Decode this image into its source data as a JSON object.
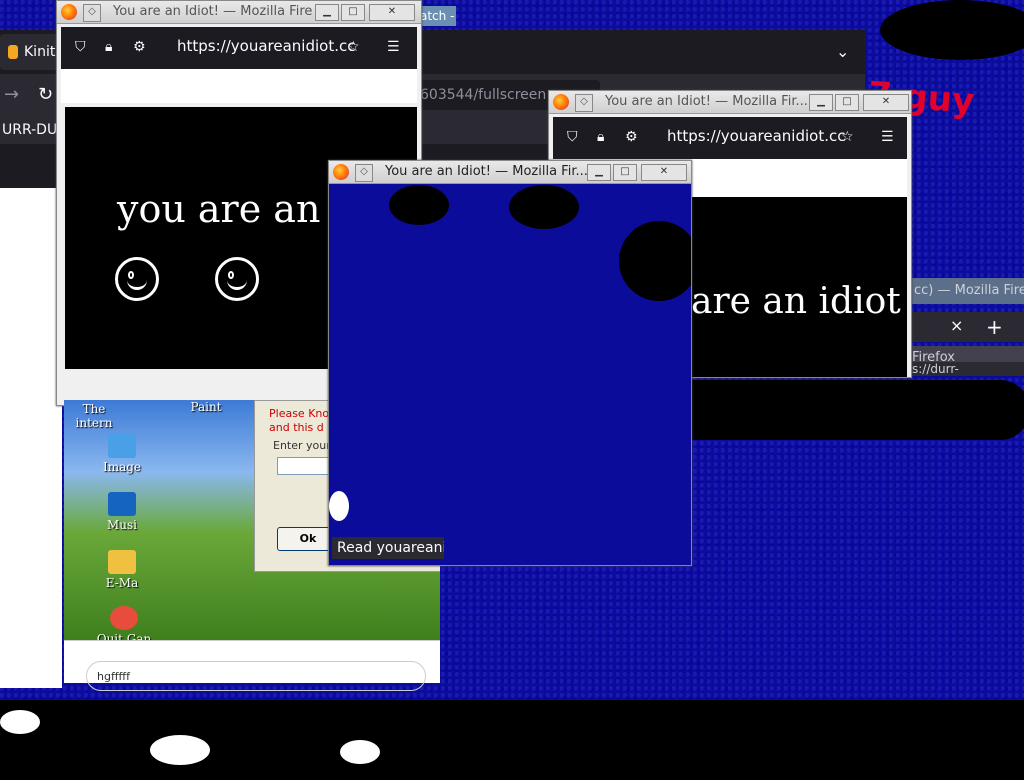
{
  "base_browser": {
    "tab_label": "Kinit",
    "url_fragment": "603544/fullscreen",
    "bookmark_text": "URR-DURR",
    "background_window_title": "atch -"
  },
  "popup1": {
    "title": "You are an Idiot! — Mozilla Fire",
    "url": "https://youareanidiot.cc",
    "headline": "you are an idi"
  },
  "popup2": {
    "title": "You are an Idiot! — Mozilla Fir...",
    "url": "https://youareanidiot.cc",
    "headline": "are an idiot"
  },
  "popup3": {
    "title": "You are an Idiot! — Mozilla Fir...",
    "status": "Read youareani"
  },
  "right_fragments": {
    "red_text": "7 guy",
    "titlebar_text": "cc) — Mozilla Firef",
    "behind_title": "ou are an Idiot! (dot cc) — Mozilla Firefox",
    "behind_url": "s://durr-",
    "tab_close": "×",
    "tab_new": "+",
    "tab_paren": ")"
  },
  "desktop": {
    "icons": [
      {
        "label": "The intern",
        "color": "#3b6fd1"
      },
      {
        "label": "Paint",
        "color": "#3b6fd1"
      },
      {
        "label": "Image",
        "color": "#4aa0e6"
      },
      {
        "label": "Musi",
        "color": "#1565c0"
      },
      {
        "label": "E-Ma",
        "color": "#f0c040"
      },
      {
        "label": "Quit Gan",
        "color": "#e74c3c"
      }
    ],
    "dialog": {
      "warning_line1": "Please Kno",
      "warning_line2": "and this d",
      "enter_label": "Enter your",
      "ok_label": "Ok"
    },
    "input_value": "hgfffff"
  },
  "colors": {
    "background_blue": "#0c0c9a",
    "firefox_dark": "#1c1b22",
    "accent_red": "#e3002a"
  }
}
